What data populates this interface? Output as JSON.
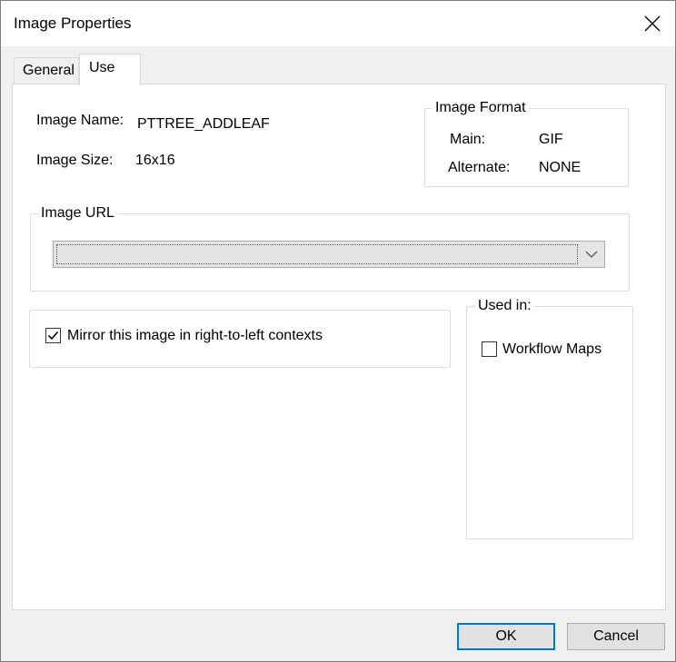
{
  "window": {
    "title": "Image Properties",
    "close_icon": "close-icon"
  },
  "tabs": [
    {
      "label": "General",
      "active": false
    },
    {
      "label": "Use",
      "active": true
    }
  ],
  "image_info": {
    "name_label": "Image Name:",
    "name_value": "PTTREE_ADDLEAF",
    "size_label": "Image Size:",
    "size_value": "16x16"
  },
  "image_format": {
    "caption": "Image Format",
    "main_label": "Main:",
    "main_value": "GIF",
    "alternate_label": "Alternate:",
    "alternate_value": "NONE"
  },
  "image_url": {
    "caption": "Image URL",
    "selected_value": ""
  },
  "mirror": {
    "label": "Mirror this image in right-to-left contexts",
    "checked": true
  },
  "used_in": {
    "caption": "Used in:",
    "items": [
      {
        "label": "Workflow Maps",
        "checked": false
      }
    ]
  },
  "buttons": {
    "ok": "OK",
    "cancel": "Cancel"
  },
  "colors": {
    "accent": "#0078d7",
    "background": "#f0f0f0",
    "panel": "#ffffff"
  }
}
